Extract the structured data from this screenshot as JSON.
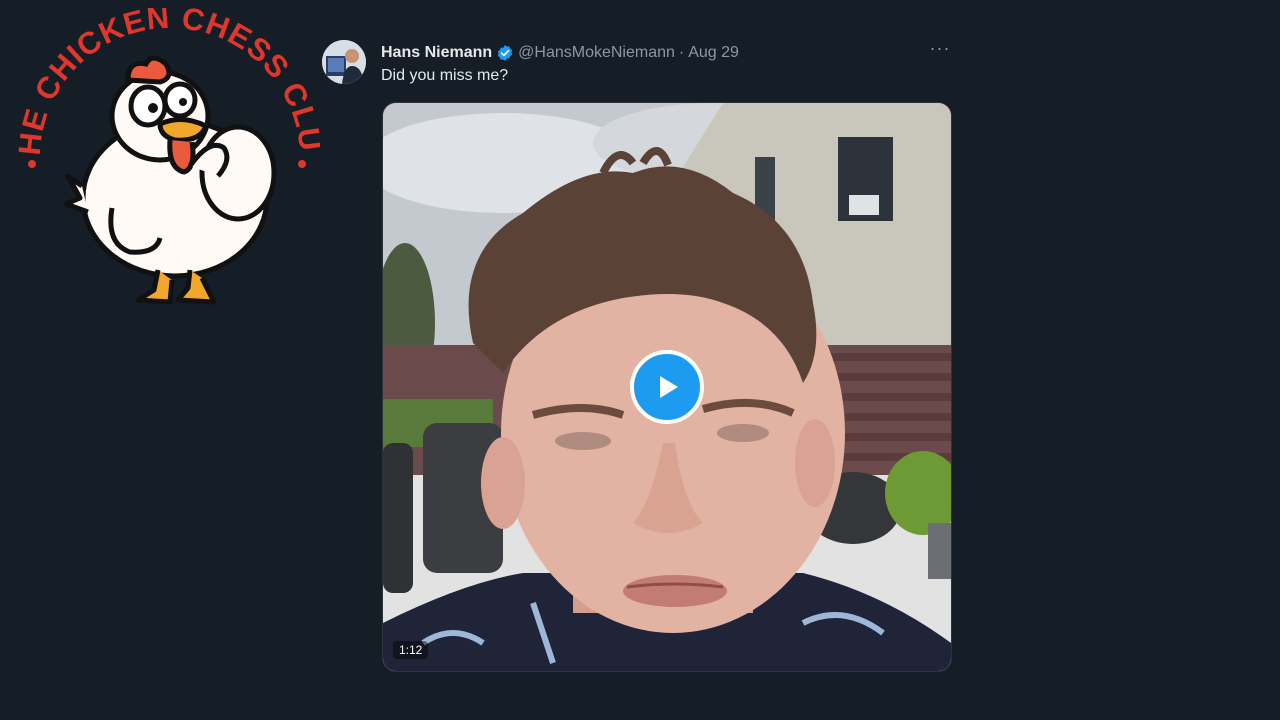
{
  "logo": {
    "text": "THE CHICKEN CHESS CLUB",
    "color": "#e0372c"
  },
  "tweet": {
    "display_name": "Hans Niemann",
    "handle": "@HansMokeNiemann",
    "separator": "·",
    "date": "Aug 29",
    "text": "Did you miss me?",
    "more_icon": "more-horizontal-icon",
    "verified_color": "#1d9bf0",
    "media": {
      "duration": "1:12",
      "play_icon": "play-icon"
    }
  },
  "colors": {
    "background": "#151d27",
    "accent": "#1d9bf0",
    "text_primary": "#e7e9ea",
    "text_secondary": "#8b98a5"
  }
}
